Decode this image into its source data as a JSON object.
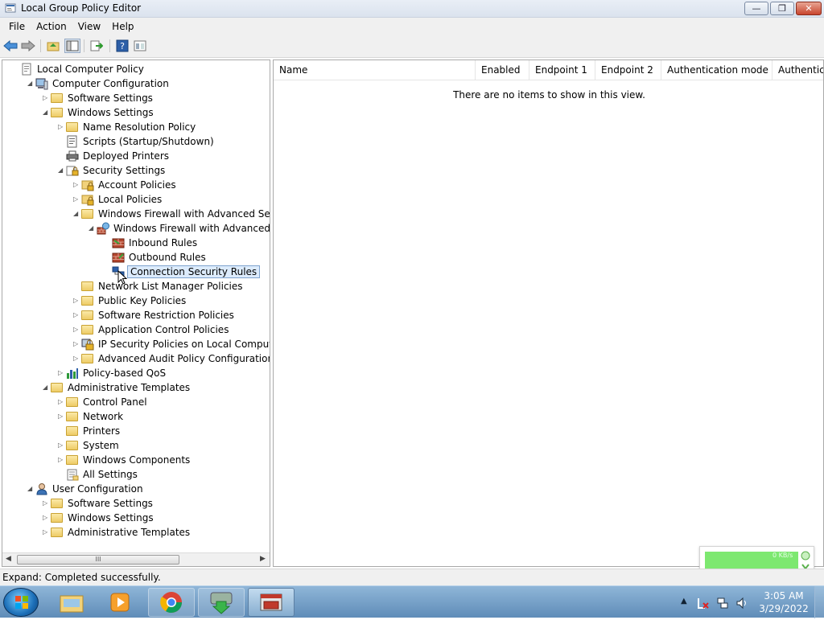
{
  "window": {
    "title": "Local Group Policy Editor",
    "buttons": {
      "minimize": "—",
      "restore": "❐",
      "close": "✕"
    }
  },
  "menu": [
    "File",
    "Action",
    "View",
    "Help"
  ],
  "toolbar": [
    "back-icon",
    "forward-icon",
    "up-folder-icon",
    "show-hide-tree-icon",
    "export-list-icon",
    "help-icon",
    "properties-icon"
  ],
  "tree": [
    {
      "label": "Local Computer Policy",
      "expander": "",
      "icon": "policy-icon"
    },
    {
      "label": "Computer Configuration",
      "expander": "◢",
      "icon": "computer-icon"
    },
    {
      "label": "Software Settings",
      "expander": "▷",
      "icon": "folder-icon"
    },
    {
      "label": "Windows Settings",
      "expander": "◢",
      "icon": "folder-icon"
    },
    {
      "label": "Name Resolution Policy",
      "expander": "▷",
      "icon": "folder-icon"
    },
    {
      "label": "Scripts (Startup/Shutdown)",
      "expander": "",
      "icon": "script-icon"
    },
    {
      "label": "Deployed Printers",
      "expander": "",
      "icon": "printer-icon"
    },
    {
      "label": "Security Settings",
      "expander": "◢",
      "icon": "security-icon"
    },
    {
      "label": "Account Policies",
      "expander": "▷",
      "icon": "folder-lock-icon"
    },
    {
      "label": "Local Policies",
      "expander": "▷",
      "icon": "folder-lock-icon"
    },
    {
      "label": "Windows Firewall with Advanced Security",
      "expander": "◢",
      "icon": "folder-icon"
    },
    {
      "label": "Windows Firewall with Advanced Security - Local Group Policy Object",
      "expander": "◢",
      "icon": "firewall-icon"
    },
    {
      "label": "Inbound Rules",
      "expander": "",
      "icon": "inbound-rules-icon"
    },
    {
      "label": "Outbound Rules",
      "expander": "",
      "icon": "outbound-rules-icon"
    },
    {
      "label": "Connection Security Rules",
      "expander": "",
      "icon": "connection-security-icon",
      "selected": true
    },
    {
      "label": "Network List Manager Policies",
      "expander": "",
      "icon": "folder-icon"
    },
    {
      "label": "Public Key Policies",
      "expander": "▷",
      "icon": "folder-icon"
    },
    {
      "label": "Software Restriction Policies",
      "expander": "▷",
      "icon": "folder-icon"
    },
    {
      "label": "Application Control Policies",
      "expander": "▷",
      "icon": "folder-icon"
    },
    {
      "label": "IP Security Policies on Local Computer",
      "expander": "▷",
      "icon": "ip-security-icon"
    },
    {
      "label": "Advanced Audit Policy Configuration",
      "expander": "▷",
      "icon": "folder-icon"
    },
    {
      "label": "Policy-based QoS",
      "expander": "▷",
      "icon": "qos-chart-icon"
    },
    {
      "label": "Administrative Templates",
      "expander": "◢",
      "icon": "folder-icon"
    },
    {
      "label": "Control Panel",
      "expander": "▷",
      "icon": "folder-icon"
    },
    {
      "label": "Network",
      "expander": "▷",
      "icon": "folder-icon"
    },
    {
      "label": "Printers",
      "expander": "",
      "icon": "folder-icon"
    },
    {
      "label": "System",
      "expander": "▷",
      "icon": "folder-icon"
    },
    {
      "label": "Windows Components",
      "expander": "▷",
      "icon": "folder-icon"
    },
    {
      "label": "All Settings",
      "expander": "",
      "icon": "all-settings-icon"
    },
    {
      "label": "User Configuration",
      "expander": "◢",
      "icon": "user-icon"
    },
    {
      "label": "Software Settings",
      "expander": "▷",
      "icon": "folder-icon"
    },
    {
      "label": "Windows Settings",
      "expander": "▷",
      "icon": "folder-icon"
    },
    {
      "label": "Administrative Templates",
      "expander": "▷",
      "icon": "folder-icon"
    }
  ],
  "tree_scrollbar_grip": "III",
  "list": {
    "columns": [
      "Name",
      "Enabled",
      "Endpoint 1",
      "Endpoint 2",
      "Authentication mode",
      "Authentica"
    ],
    "empty_message": "There are no items to show in this view."
  },
  "status": "Expand:  Completed successfully.",
  "net_widget": {
    "text": "0 KB/s"
  },
  "taskbar": {
    "apps": [
      "explorer-icon",
      "media-player-icon",
      "chrome-icon",
      "download-manager-icon",
      "group-policy-icon"
    ],
    "clock_time": "3:05 AM",
    "clock_date": "3/29/2022"
  },
  "colors": {
    "selection": "#dcebfc",
    "selection_border": "#7da2ce",
    "net_bar": "#7de870"
  }
}
